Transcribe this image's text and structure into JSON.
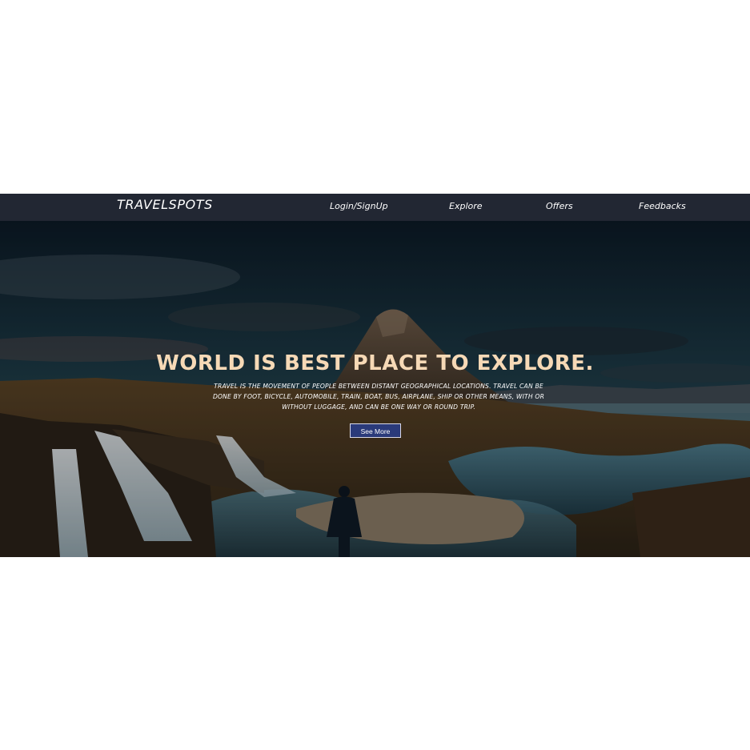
{
  "nav": {
    "brand": "TRAVELSPOTS",
    "links": [
      "Login/SignUp",
      "Explore",
      "Offers",
      "Feedbacks"
    ]
  },
  "hero": {
    "headline": "WORLD IS BEST PLACE TO EXPLORE.",
    "description": "TRAVEL IS THE MOVEMENT OF PEOPLE BETWEEN DISTANT GEOGRAPHICAL LOCATIONS. TRAVEL CAN BE DONE BY FOOT, BICYCLE, AUTOMOBILE, TRAIN, BOAT, BUS, AIRPLANE, SHIP OR OTHER MEANS, WITH OR WITHOUT LUGGAGE, AND CAN BE ONE WAY OR ROUND TRIP.",
    "button": "See More"
  },
  "colors": {
    "navbar": "#222733",
    "headline": "#f6d9b6",
    "button": "#2a3a7a"
  }
}
